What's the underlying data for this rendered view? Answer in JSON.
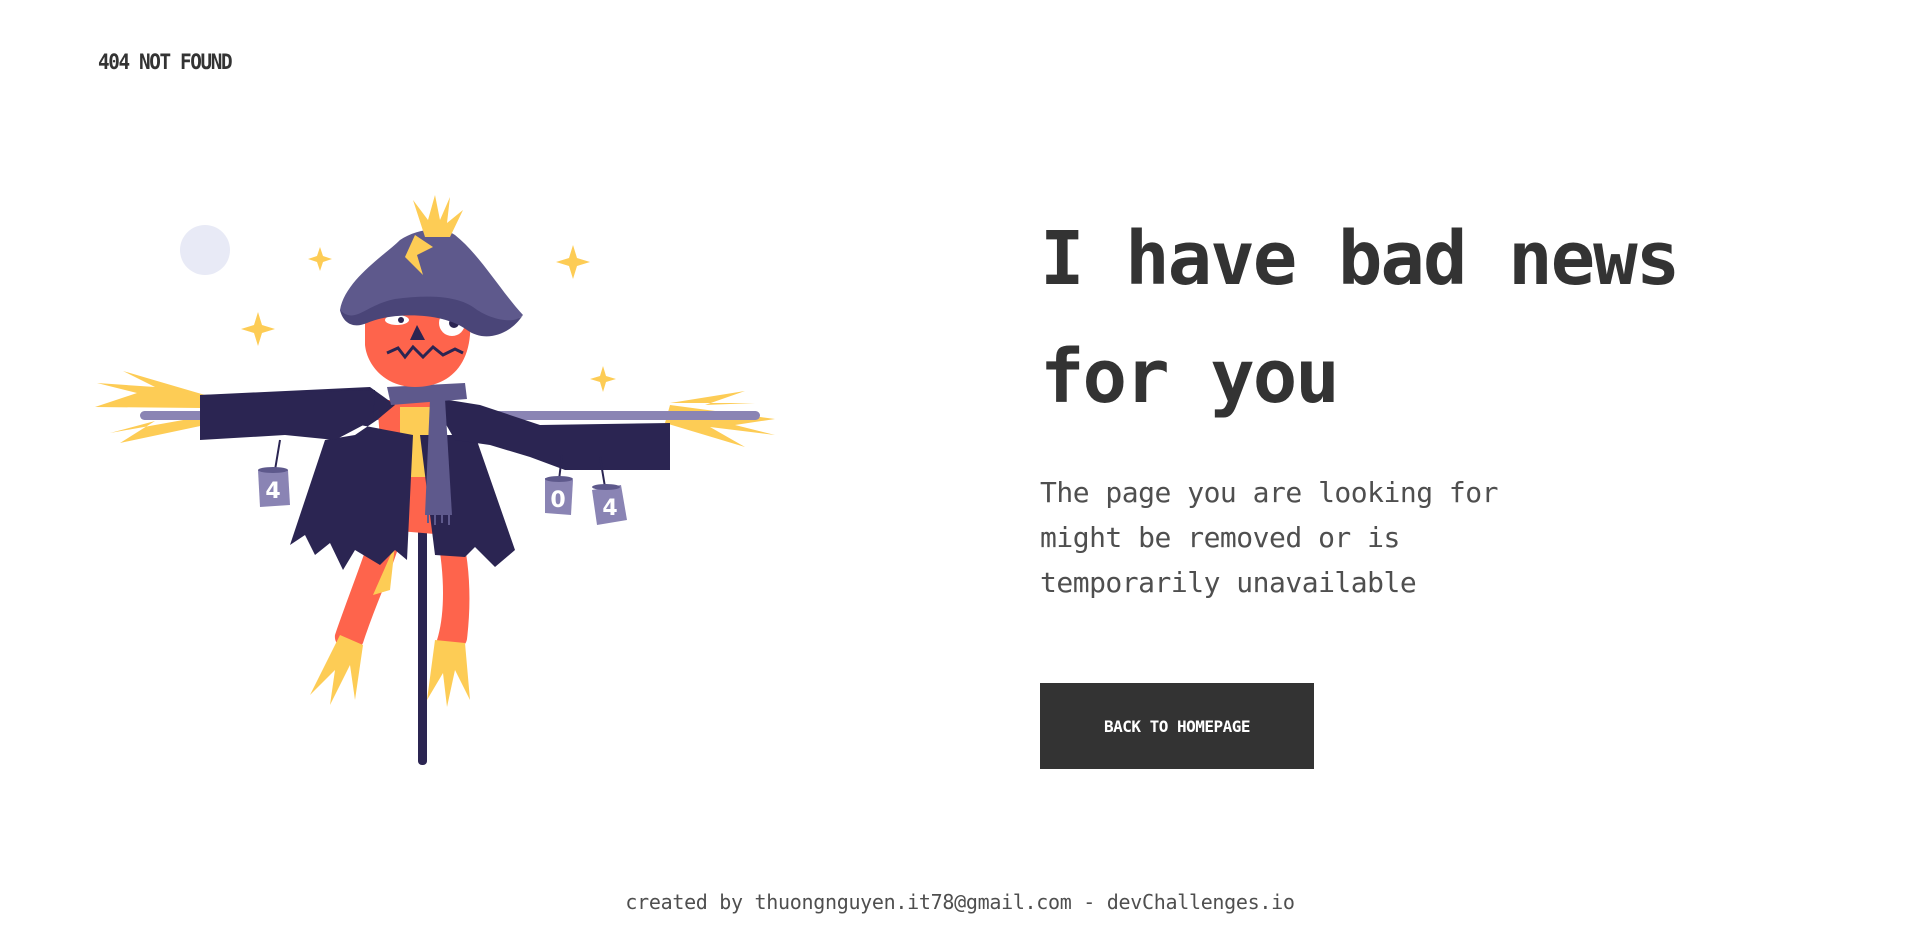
{
  "header": {
    "logo_text": "404 NOT FOUND"
  },
  "illustration": {
    "name": "scarecrow-illustration",
    "can_labels": [
      "4",
      "0",
      "4"
    ]
  },
  "main": {
    "headline": "I have bad news for you",
    "description": "The page you are looking for might be removed or is temporarily unavailable",
    "cta_label": "BACK TO HOMEPAGE"
  },
  "footer": {
    "prefix": "created by ",
    "author_email": "thuongnguyen.it78@gmail.com",
    "separator": " - ",
    "site": "devChallenges.io"
  },
  "colors": {
    "text": "#333333",
    "button_bg": "#333333",
    "button_text": "#ffffff",
    "hat": "#5e598c",
    "coat": "#2b2552",
    "face": "#fe644c",
    "straw": "#fdcc55",
    "can": "#8a84b4"
  }
}
